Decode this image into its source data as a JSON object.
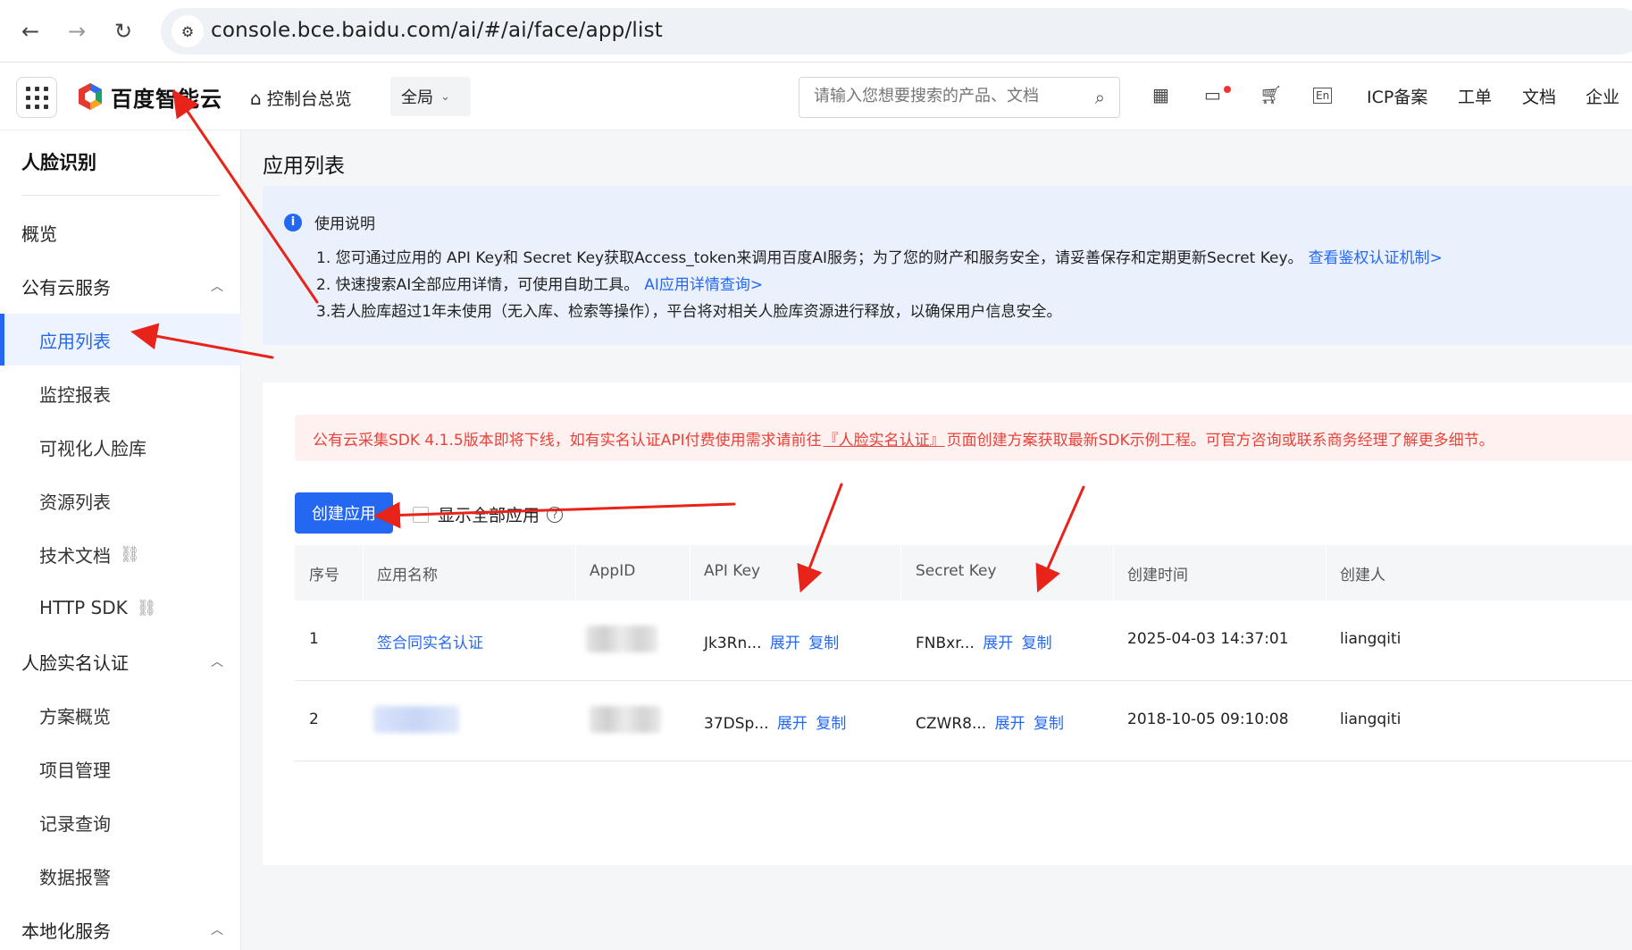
{
  "browser": {
    "back_icon": "←",
    "forward_icon": "→",
    "reload_icon": "↻",
    "url": "console.bce.baidu.com/ai/#/ai/face/app/list"
  },
  "topbar": {
    "logo_text": "百度智能云",
    "home_label": "控制台总览",
    "region_label": "全局",
    "search_placeholder": "请输入您想要搜索的产品、文档",
    "links": [
      "ICP备案",
      "工单",
      "文档",
      "企业"
    ],
    "lang_icon_text": "En"
  },
  "sidebar": {
    "title": "人脸识别",
    "items": [
      {
        "label": "概览",
        "type": "group"
      },
      {
        "label": "公有云服务",
        "type": "group",
        "expanded": true
      },
      {
        "label": "应用列表",
        "type": "sub",
        "active": true
      },
      {
        "label": "监控报表",
        "type": "sub"
      },
      {
        "label": "可视化人脸库",
        "type": "sub"
      },
      {
        "label": "资源列表",
        "type": "sub"
      },
      {
        "label": "技术文档",
        "type": "sub",
        "external": true
      },
      {
        "label": "HTTP SDK",
        "type": "sub",
        "external": true
      },
      {
        "label": "人脸实名认证",
        "type": "group",
        "expanded": true
      },
      {
        "label": "方案概览",
        "type": "sub"
      },
      {
        "label": "项目管理",
        "type": "sub"
      },
      {
        "label": "记录查询",
        "type": "sub"
      },
      {
        "label": "数据报警",
        "type": "sub"
      },
      {
        "label": "本地化服务",
        "type": "group",
        "expanded": true
      }
    ]
  },
  "main": {
    "page_title": "应用列表",
    "info": {
      "heading": "使用说明",
      "line1": "1. 您可通过应用的 API Key和 Secret Key获取Access_token来调用百度AI服务；为了您的财产和服务安全，请妥善保存和定期更新Secret Key。",
      "line1_link": "查看鉴权认证机制>",
      "line2": "2. 快速搜索AI全部应用详情，可使用自助工具。",
      "line2_link": "AI应用详情查询>",
      "line3": "3.若人脸库超过1年未使用（无入库、检索等操作），平台将对相关人脸库资源进行释放，以确保用户信息安全。"
    },
    "alert": {
      "prefix": "公有云采集SDK 4.1.5版本即将下线，如有实名认证API付费使用需求请前往",
      "link": "『人脸实名认证』",
      "suffix": "页面创建方案获取最新SDK示例工程。可官方咨询或联系商务经理了解更多细节。"
    },
    "create_button": "创建应用",
    "show_all_label": "显示全部应用",
    "table": {
      "headers": [
        "序号",
        "应用名称",
        "AppID",
        "API Key",
        "Secret Key",
        "创建时间",
        "创建人"
      ],
      "rows": [
        {
          "index": "1",
          "name": "签合同实名认证",
          "appid": "",
          "api_key": "Jk3Rn...",
          "secret_key": "FNBxr...",
          "created": "2025-04-03 14:37:01",
          "creator": "liangqiti"
        },
        {
          "index": "2",
          "name": "",
          "appid": "",
          "api_key": "37DSp...",
          "secret_key": "CZWR8...",
          "created": "2018-10-05 09:10:08",
          "creator": "liangqiti"
        }
      ],
      "expand_label": "展开",
      "copy_label": "复制"
    }
  },
  "colors": {
    "accent": "#2468f2",
    "alert_text": "#e8423a",
    "annotation": "#e8231a"
  }
}
